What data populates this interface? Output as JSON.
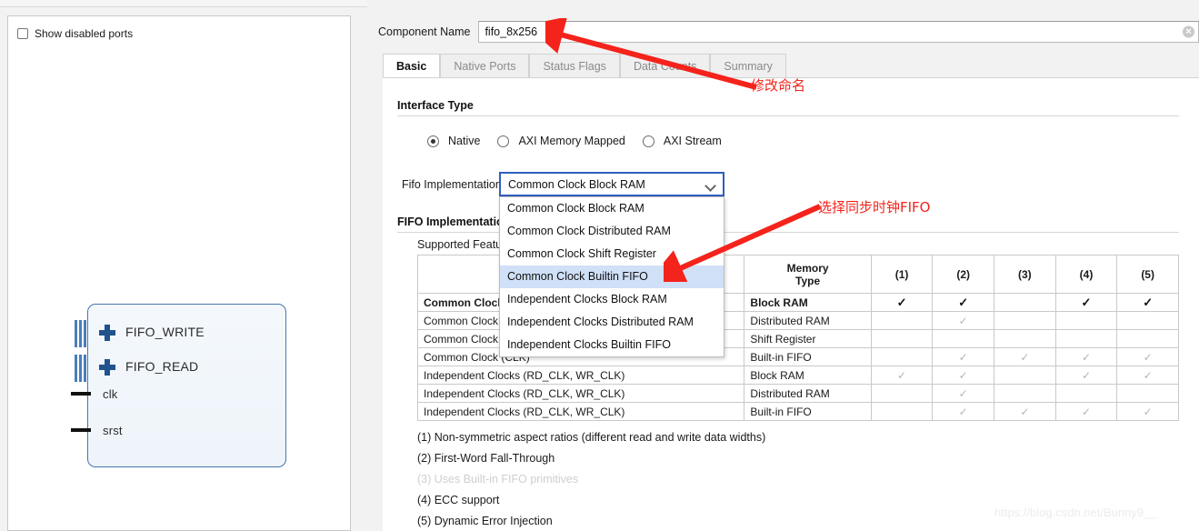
{
  "left_panel": {
    "show_disabled_ports_label": "Show disabled ports",
    "symbol": {
      "bus_ports": [
        "FIFO_WRITE",
        "FIFO_READ"
      ],
      "pin_ports": [
        "clk",
        "srst"
      ]
    }
  },
  "component_name": {
    "label": "Component Name",
    "value": "fifo_8x256",
    "placeholder": "Component Name"
  },
  "tabs": [
    {
      "label": "Basic",
      "active": true
    },
    {
      "label": "Native Ports",
      "active": false
    },
    {
      "label": "Status Flags",
      "active": false
    },
    {
      "label": "Data Counts",
      "active": false
    },
    {
      "label": "Summary",
      "active": false
    }
  ],
  "interface_type": {
    "title": "Interface Type",
    "options": [
      {
        "label": "Native",
        "selected": true
      },
      {
        "label": "AXI Memory Mapped",
        "selected": false
      },
      {
        "label": "AXI Stream",
        "selected": false
      }
    ]
  },
  "fifo_implementation": {
    "label": "Fifo Implementation",
    "selected": "Common Clock Block RAM",
    "highlighted": "Common Clock Builtin FIFO",
    "options": [
      "Common Clock Block RAM",
      "Common Clock Distributed RAM",
      "Common Clock Shift Register",
      "Common Clock Builtin FIFO",
      "Independent Clocks Block RAM",
      "Independent Clocks Distributed RAM",
      "Independent Clocks Builtin FIFO"
    ]
  },
  "fifo_implementation_options": {
    "title": "FIFO Implementation Options",
    "subtitle": "Supported Features"
  },
  "table": {
    "headers": [
      "",
      "Memory\nType",
      "(1)",
      "(2)",
      "(3)",
      "(4)",
      "(5)"
    ],
    "header_clock": "",
    "header_memory_type_line1": "Memory",
    "header_memory_type_line2": "Type",
    "header_cols": [
      "(1)",
      "(2)",
      "(3)",
      "(4)",
      "(5)"
    ],
    "rows": [
      {
        "clock": "Common Clock (CLK)",
        "memory": "Block RAM",
        "bold": true,
        "marks": [
          "dark",
          "dark",
          "",
          "dark",
          "dark"
        ]
      },
      {
        "clock": "Common Clock (CLK)",
        "memory": "Distributed RAM",
        "bold": false,
        "marks": [
          "",
          "light",
          "",
          "",
          ""
        ]
      },
      {
        "clock": "Common Clock (CLK)",
        "memory": "Shift Register",
        "bold": false,
        "marks": [
          "",
          "",
          "",
          "",
          ""
        ]
      },
      {
        "clock": "Common Clock (CLK)",
        "memory": "Built-in FIFO",
        "bold": false,
        "marks": [
          "",
          "light",
          "light",
          "light",
          "light"
        ]
      },
      {
        "clock": "Independent Clocks (RD_CLK, WR_CLK)",
        "memory": "Block RAM",
        "bold": false,
        "marks": [
          "light",
          "light",
          "",
          "light",
          "light"
        ]
      },
      {
        "clock": "Independent Clocks (RD_CLK, WR_CLK)",
        "memory": "Distributed RAM",
        "bold": false,
        "marks": [
          "",
          "light",
          "",
          "",
          ""
        ]
      },
      {
        "clock": "Independent Clocks (RD_CLK, WR_CLK)",
        "memory": "Built-in FIFO",
        "bold": false,
        "marks": [
          "",
          "light",
          "light",
          "light",
          "light"
        ]
      }
    ],
    "tick_glyph": "✓"
  },
  "notes": [
    {
      "text": "(1) Non-symmetric aspect ratios (different read and write data widths)",
      "dim": false
    },
    {
      "text": "(2) First-Word Fall-Through",
      "dim": false
    },
    {
      "text": "(3) Uses Built-in FIFO primitives",
      "dim": true
    },
    {
      "text": "(4) ECC support",
      "dim": false
    },
    {
      "text": "(5) Dynamic Error Injection",
      "dim": false
    }
  ],
  "annotations": [
    {
      "text": "修改命名",
      "color": "#f4231b"
    },
    {
      "text": "选择同步时钟FIFO",
      "color": "#f4231b"
    }
  ],
  "watermark": "https://blog.csdn.net/Bunny9__",
  "colors": {
    "accent_blue": "#2f5fbf",
    "highlight": "#cfe0f7",
    "annotation_red": "#f4231b",
    "symbol_border": "#4477aa",
    "bus_blue": "#4a7ebb"
  }
}
